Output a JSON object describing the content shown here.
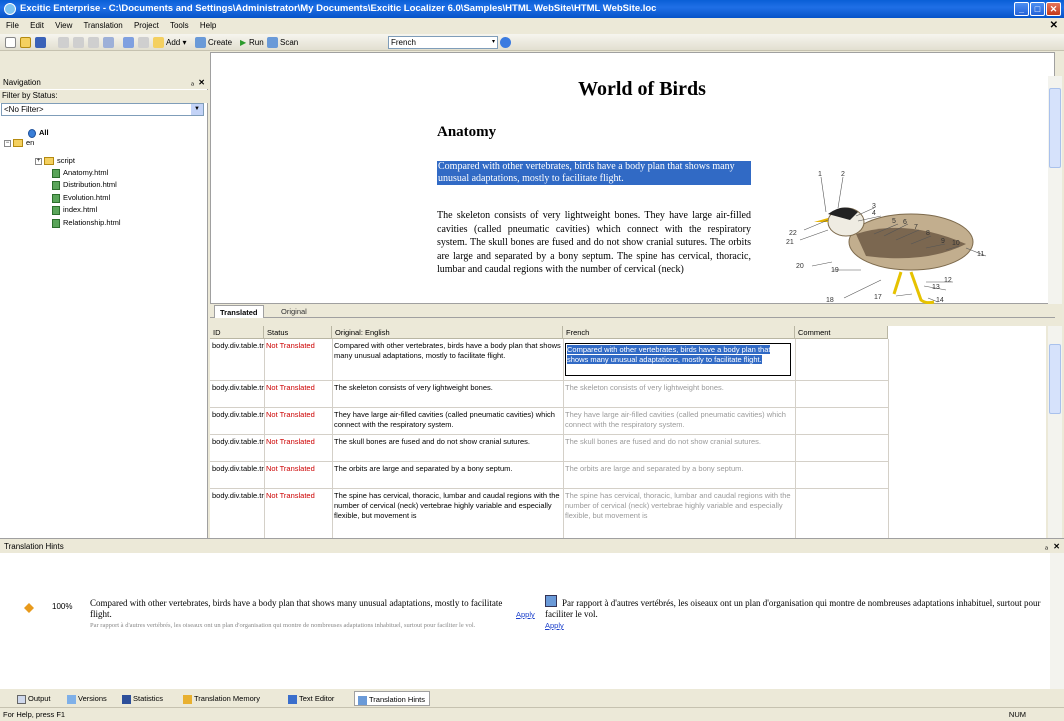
{
  "window": {
    "title": "Excitic Enterprise - C:\\Documents and Settings\\Administrator\\My Documents\\Excitic Localizer 6.0\\Samples\\HTML WebSite\\HTML WebSite.loc"
  },
  "menu": [
    "File",
    "Edit",
    "View",
    "Translation",
    "Project",
    "Tools",
    "Help"
  ],
  "toolbar": {
    "add_label": "Add",
    "create_label": "Create",
    "run_label": "Run",
    "scan_label": "Scan",
    "language": "French"
  },
  "navigation": {
    "title": "Navigation",
    "filter_label": "Filter by Status:",
    "filter_value": "<No Filter>",
    "tree": {
      "all": "All",
      "lang": "en",
      "script": "script",
      "files": [
        "Anatomy.html",
        "Distribution.html",
        "Evolution.html",
        "index.html",
        "Relationship.html"
      ]
    }
  },
  "preview": {
    "heading": "World of Birds",
    "subheading": "Anatomy",
    "highlighted_paragraph": "Compared with other vertebrates, birds have a body plan that shows many unusual adaptations, mostly to facilitate flight.",
    "paragraph": "The skeleton consists of very lightweight bones. They have large air-filled cavities (called pneumatic cavities) which connect with the respiratory system. The skull bones are fused and do not show cranial sutures. The orbits are large and separated by a bony septum. The spine has cervical, thoracic, lumbar and caudal regions with the number of cervical (neck)",
    "diagram_numbers": [
      "1",
      "2",
      "3",
      "4",
      "5",
      "6",
      "7",
      "8",
      "9",
      "10",
      "11",
      "12",
      "13",
      "14",
      "17",
      "18",
      "19",
      "20",
      "21",
      "22"
    ]
  },
  "tabs": {
    "translated": "Translated",
    "original": "Original"
  },
  "grid": {
    "columns": {
      "id": "ID",
      "status": "Status",
      "original": "Original: English",
      "french": "French",
      "comment": "Comment"
    },
    "rows": [
      {
        "id": "body.div.table.tr.td.p",
        "status": "Not Translated",
        "original": "Compared with other vertebrates, birds have a body plan that shows many unusual adaptations, mostly to facilitate flight.",
        "french": "Compared with other vertebrates, birds have a body plan that shows many unusual adaptations, mostly to facilitate flight."
      },
      {
        "id": "body.div.table.tr.td.p",
        "status": "Not Translated",
        "original": "The skeleton consists of very lightweight bones.",
        "french": "The skeleton consists of very lightweight bones."
      },
      {
        "id": "body.div.table.tr.td.p",
        "status": "Not Translated",
        "original": "They have large air-filled cavities (called pneumatic cavities) which connect with the respiratory system.",
        "french": "They have large air-filled cavities (called pneumatic cavities) which connect with the respiratory system."
      },
      {
        "id": "body.div.table.tr.td.p",
        "status": "Not Translated",
        "original": "The skull bones are fused and do not show cranial sutures.",
        "french": "The skull bones are fused and do not show cranial sutures."
      },
      {
        "id": "body.div.table.tr.td.p",
        "status": "Not Translated",
        "original": "The orbits are large and separated by a bony septum.",
        "french": "The orbits are large and separated by a bony septum."
      },
      {
        "id": "body.div.table.tr.td.p",
        "status": "Not Translated",
        "original": "The spine has cervical, thoracic, lumbar and caudal regions with the number of cervical (neck) vertebrae highly variable and especially flexible, but movement is",
        "french": "The spine has cervical, thoracic, lumbar and caudal regions with the number of cervical (neck) vertebrae highly variable and especially flexible, but movement is"
      }
    ]
  },
  "hints": {
    "title": "Translation Hints",
    "percent": "100%",
    "source_text": "Compared with other vertebrates, birds have a body plan that shows many unusual adaptations, mostly to facilitate flight.",
    "source_sub": "Par rapport à d'autres vertébrés, les oiseaux ont un plan d'organisation qui montre de nombreuses adaptations inhabituel, surtout pour faciliter le vol.",
    "apply_label": "Apply",
    "translation_text": "Par rapport à d'autres vertébrés, les oiseaux ont un plan d'organisation qui montre de nombreuses adaptations inhabituel, surtout pour faciliter le vol.",
    "apply_label2": "Apply"
  },
  "bottom_tabs": [
    "Output",
    "Versions",
    "Statistics",
    "Translation Memory",
    "Text Editor",
    "Translation Hints"
  ],
  "status": {
    "help": "For Help, press F1",
    "num": "NUM"
  },
  "colors": {
    "titlebar": "#0a5fd6",
    "selection": "#316ac5",
    "not_translated": "#cc0000"
  }
}
